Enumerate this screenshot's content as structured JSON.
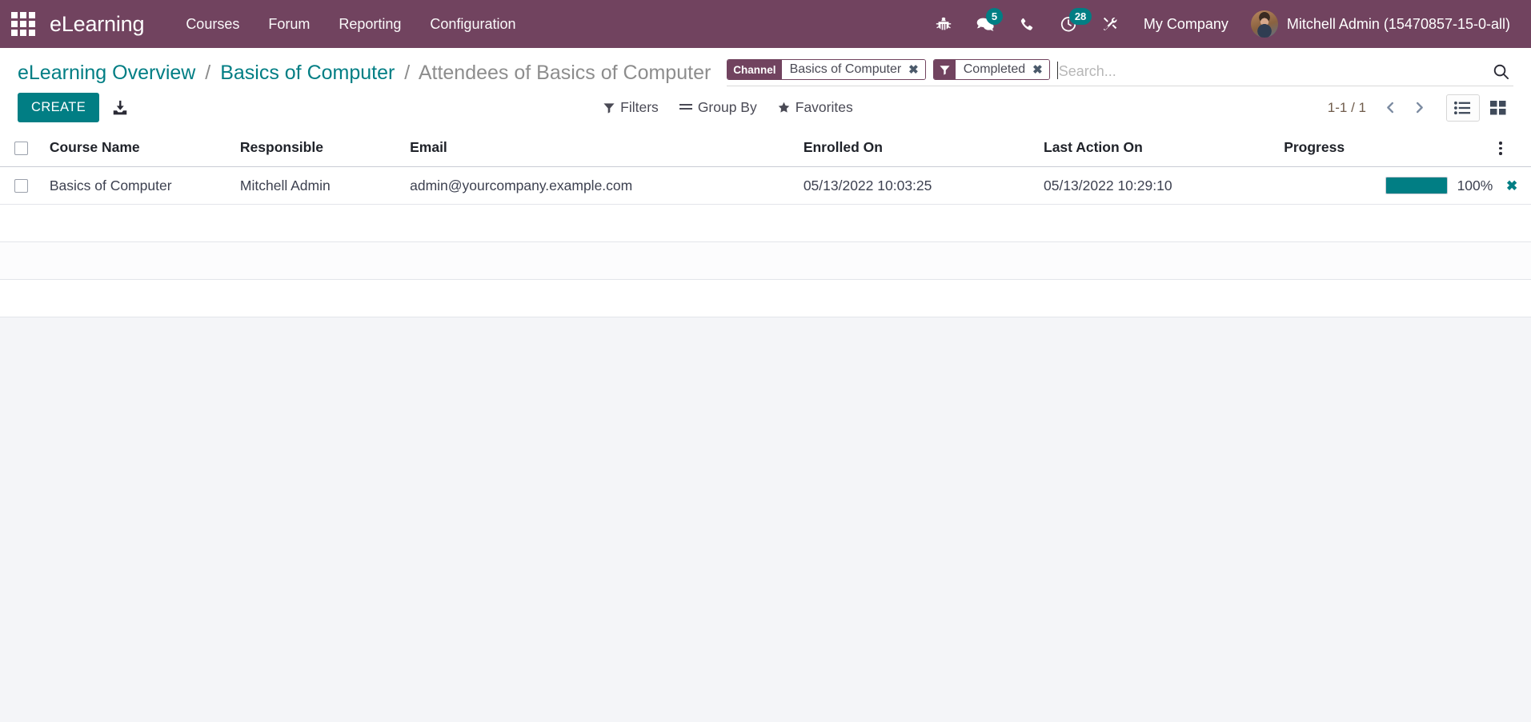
{
  "navbar": {
    "apps_icon": "apps-grid-icon",
    "brand": "eLearning",
    "menu_items": [
      {
        "label": "Courses"
      },
      {
        "label": "Forum"
      },
      {
        "label": "Reporting"
      },
      {
        "label": "Configuration"
      }
    ],
    "system_icons": [
      {
        "name": "bug-icon",
        "badge": ""
      },
      {
        "name": "messages-icon",
        "badge": "5"
      },
      {
        "name": "phone-icon",
        "badge": ""
      },
      {
        "name": "activities-clock-icon",
        "badge": "28"
      },
      {
        "name": "tools-icon",
        "badge": ""
      }
    ],
    "company": "My Company",
    "user": "Mitchell Admin (15470857-15-0-all)",
    "bg_color": "#71435f",
    "badge_color": "#017e84"
  },
  "breadcrumb": {
    "root": "eLearning Overview",
    "parent": "Basics of Computer",
    "current": "Attendees of Basics of Computer",
    "separator": "/"
  },
  "search": {
    "placeholder": "Search...",
    "value": "",
    "search_icon": "magnifier-icon",
    "facets": [
      {
        "label": "Channel",
        "label_icon": "",
        "value": "Basics of Computer",
        "remove": "✖"
      },
      {
        "label": "",
        "label_icon": "filter-funnel-icon",
        "value": "Completed",
        "remove": "✖"
      }
    ]
  },
  "toolbar": {
    "create_label": "CREATE",
    "import_icon": "import-download-icon",
    "filters_label": "Filters",
    "group_by_label": "Group By",
    "favorites_label": "Favorites",
    "accent_color": "#017e84"
  },
  "pager": {
    "range": "1-1 / 1",
    "prev_icon": "chevron-left-icon",
    "next_icon": "chevron-right-icon"
  },
  "view_switcher": {
    "list_icon": "list-view-icon",
    "kanban_icon": "kanban-view-icon",
    "active": "list"
  },
  "table": {
    "columns": [
      "Course Name",
      "Responsible",
      "Email",
      "Enrolled On",
      "Last Action On",
      "Progress"
    ],
    "optional_columns_icon": "vertical-dots-icon",
    "rows": [
      {
        "course_name": "Basics of Computer",
        "responsible": "Mitchell Admin",
        "email": "admin@yourcompany.example.com",
        "enrolled_on": "05/13/2022 10:03:25",
        "last_action_on": "05/13/2022 10:29:10",
        "progress_percent": 100,
        "progress_label": "100%",
        "delete_icon": "✖"
      }
    ],
    "empty_rows": 3
  }
}
